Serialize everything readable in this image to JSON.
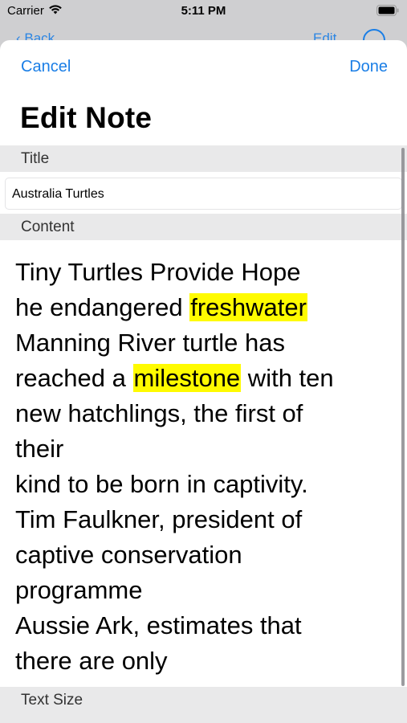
{
  "status_bar": {
    "carrier": "Carrier",
    "time": "5:11 PM",
    "icons": [
      "wifi-icon",
      "battery-icon"
    ]
  },
  "background_nav": {
    "back_label": "Back",
    "edit_label": "Edit",
    "icon": "circle-icon"
  },
  "nav": {
    "cancel_label": "Cancel",
    "done_label": "Done",
    "title": "Edit Note"
  },
  "form": {
    "title_header": "Title",
    "title_value": "Australia Turtles",
    "content_header": "Content",
    "text_size_header": "Text Size",
    "content_lines": [
      [
        "Tiny Turtles Provide Hope"
      ],
      [
        "he endangered ",
        {
          "hl": "freshwater"
        }
      ],
      [
        "Manning River turtle has"
      ],
      [
        "reached a ",
        {
          "hl": "milestone"
        },
        " with ten"
      ],
      [
        "new hatchlings, the first of"
      ],
      [
        "their"
      ],
      [
        "kind to be born in captivity."
      ],
      [
        "Tim Faulkner, president of"
      ],
      [
        "captive conservation"
      ],
      [
        "programme"
      ],
      [
        "Aussie Ark, estimates that"
      ],
      [
        "there are only"
      ]
    ]
  },
  "colors": {
    "accent": "#1a7ee6",
    "highlight": "#fffb00",
    "section_bg": "#e9e9ea"
  }
}
